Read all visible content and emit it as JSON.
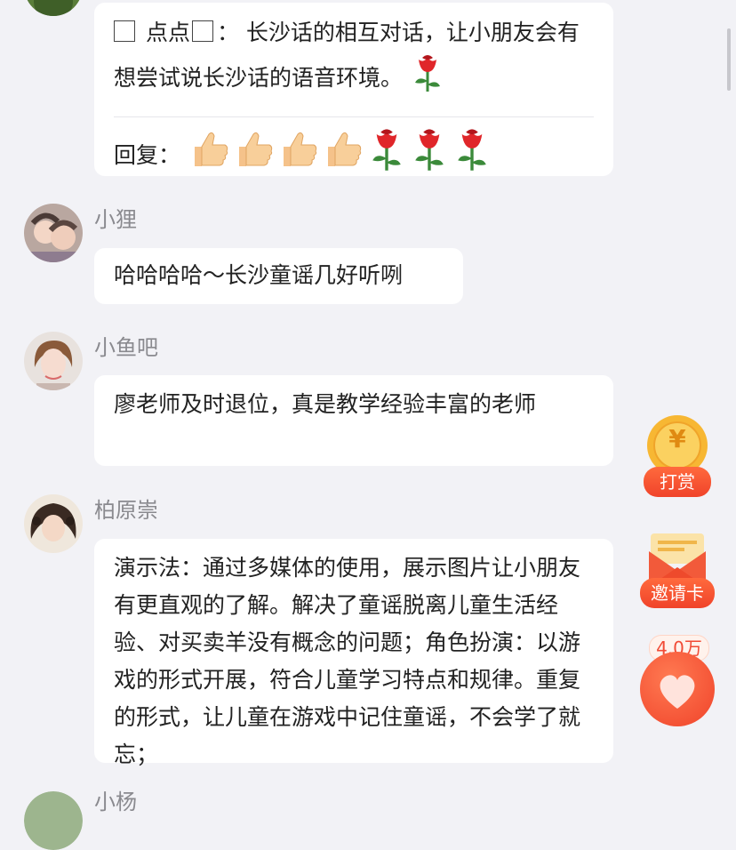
{
  "comments": [
    {
      "username": "",
      "text_prefix": "点点",
      "text": "：  长沙话的相互对话，让小朋友会有想尝试说长沙话的语音环境。",
      "reply_label": "回复："
    },
    {
      "username": "小狸",
      "text": "哈哈哈哈～长沙童谣几好听咧"
    },
    {
      "username": "小鱼吧",
      "text": "廖老师及时退位，真是教学经验丰富的老师"
    },
    {
      "username": "柏原崇",
      "text": "演示法：通过多媒体的使用，展示图片让小朋友有更直观的了解。解决了童谣脱离儿童生活经验、对买卖羊没有概念的问题；角色扮演：以游戏的形式开展，符合儿童学习特点和规律。重复的形式，让儿童在游戏中记住童谣，不会学了就忘；"
    },
    {
      "username": "小杨"
    }
  ],
  "floating": {
    "reward_label": "打赏",
    "reward_symbol": "¥",
    "invite_label": "邀请卡",
    "like_count": "4.0万"
  },
  "colors": {
    "background": "#f2f2f6",
    "accent": "#f0432a",
    "username": "#8a8a8f"
  },
  "icons": [
    "rose-icon",
    "thumbs-up-icon",
    "yuan-coin-icon",
    "red-envelope-icon",
    "heart-icon"
  ]
}
